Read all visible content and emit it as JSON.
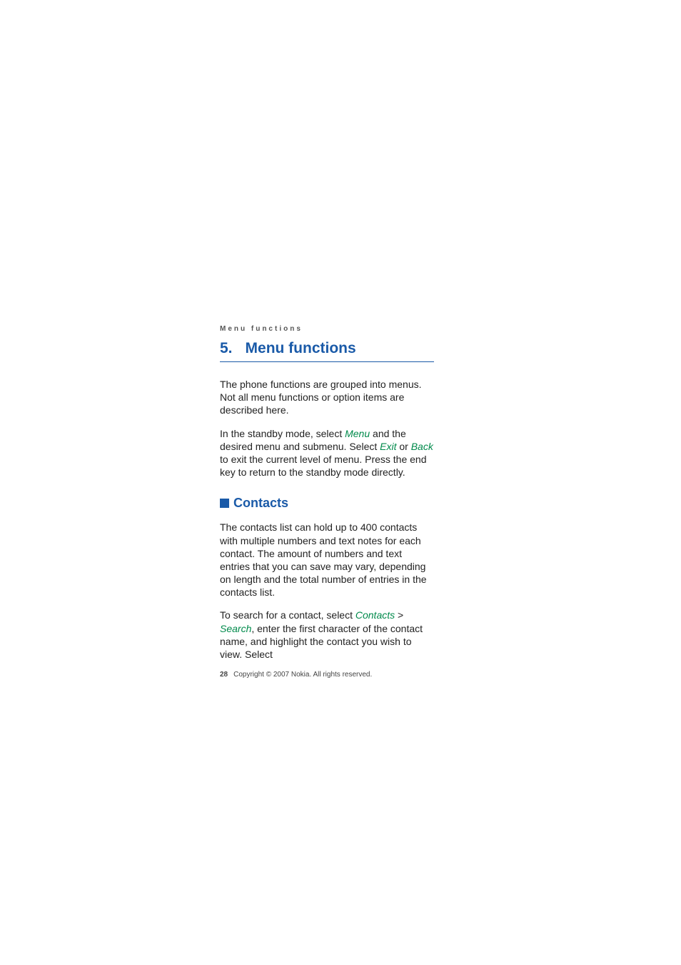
{
  "running_header": "Menu functions",
  "chapter": {
    "number": "5.",
    "title": "Menu functions"
  },
  "paragraphs": {
    "p1": "The phone functions are grouped into menus. Not all menu functions or option items are described here.",
    "p2_a": "In the standby mode, select ",
    "p2_menu": "Menu",
    "p2_b": " and the desired menu and submenu. Select ",
    "p2_exit": "Exit",
    "p2_c": " or ",
    "p2_back": "Back",
    "p2_d": " to exit the current level of menu. Press the end key to return to the standby mode directly."
  },
  "section": {
    "title": "Contacts",
    "p1": "The contacts list can hold up to 400 contacts with multiple numbers and text notes for each contact. The amount of numbers and text entries that you can save may vary, depending on length and the total number of entries in the contacts list.",
    "p2_a": "To search for a contact, select ",
    "p2_contacts": "Contacts",
    "p2_sep": " > ",
    "p2_search": "Search",
    "p2_b": ", enter the first character of the contact name, and highlight the contact you wish to view. Select"
  },
  "footer": {
    "page": "28",
    "copyright": "Copyright © 2007 Nokia. All rights reserved."
  }
}
